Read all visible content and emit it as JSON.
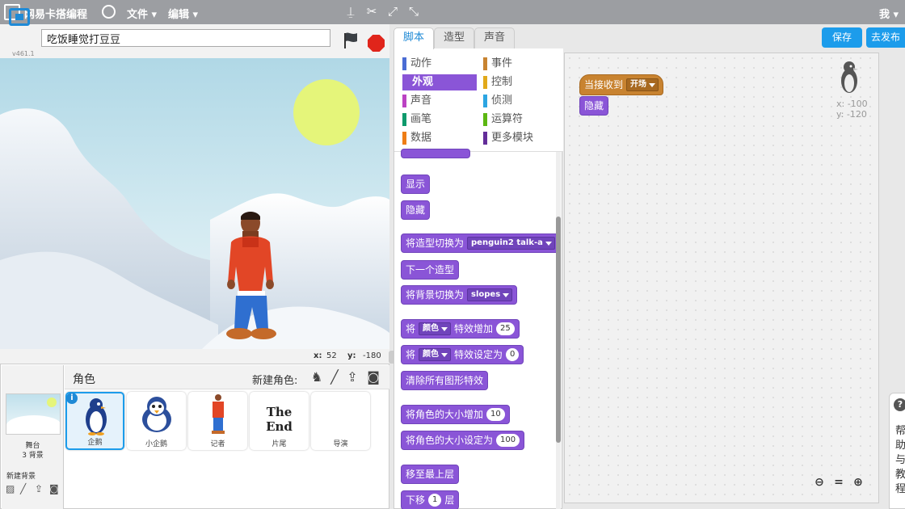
{
  "topbar": {
    "brand": "网易卡搭编程",
    "menu_file": "文件",
    "menu_edit": "编辑",
    "user": "我"
  },
  "stage": {
    "version": "v461.1",
    "project_title": "吃饭睡觉打豆豆",
    "x_label": "x:",
    "x_value": "52",
    "y_label": "y:",
    "y_value": "-180"
  },
  "sprites": {
    "header_label": "角色",
    "new_sprite_label": "新建角色:",
    "stage_name": "舞台",
    "stage_backdrops": "3 背景",
    "new_backdrop": "新建背景",
    "tiles": [
      {
        "name": "企鹅"
      },
      {
        "name": "小企鹅"
      },
      {
        "name": "记者"
      },
      {
        "name": "片尾",
        "image_text": "The End"
      },
      {
        "name": "导演"
      }
    ]
  },
  "tabs": [
    "脚本",
    "造型",
    "声音"
  ],
  "categories": [
    {
      "label": "动作",
      "color": "#4a6cd4"
    },
    {
      "label": "事件",
      "color": "#c88330"
    },
    {
      "label": "外观",
      "color": "#8a55d7",
      "active": true
    },
    {
      "label": "控制",
      "color": "#e1a91a"
    },
    {
      "label": "声音",
      "color": "#bb42c3"
    },
    {
      "label": "侦测",
      "color": "#2ca5e2"
    },
    {
      "label": "画笔",
      "color": "#0e9a6c"
    },
    {
      "label": "运算符",
      "color": "#5cb712"
    },
    {
      "label": "数据",
      "color": "#ee7d16"
    },
    {
      "label": "更多模块",
      "color": "#632d99"
    }
  ],
  "blocks": {
    "show": "显示",
    "hide": "隐藏",
    "switch_costume": "将造型切换为",
    "costume_value": "penguin2 talk-a",
    "next_costume": "下一个造型",
    "switch_backdrop": "将背景切换为",
    "backdrop_value": "slopes",
    "change_effect_a": "将",
    "effect_color": "颜色",
    "change_effect_b": "特效增加",
    "change_effect_val": "25",
    "set_effect_a": "将",
    "set_effect_b": "特效设定为",
    "set_effect_val": "0",
    "clear_effects": "清除所有图形特效",
    "change_size": "将角色的大小增加",
    "change_size_val": "10",
    "set_size": "将角色的大小设定为",
    "set_size_val": "100",
    "go_front": "移至最上层",
    "go_back_a": "下移",
    "go_back_val": "1",
    "go_back_b": "层"
  },
  "script": {
    "hat_label": "当接收到",
    "hat_value": "开场",
    "hide": "隐藏",
    "sprite_x": "x: -100",
    "sprite_y": "y: -120"
  },
  "buttons": {
    "save": "保存",
    "publish": "去发布"
  },
  "help": {
    "text": "帮助与教程"
  }
}
